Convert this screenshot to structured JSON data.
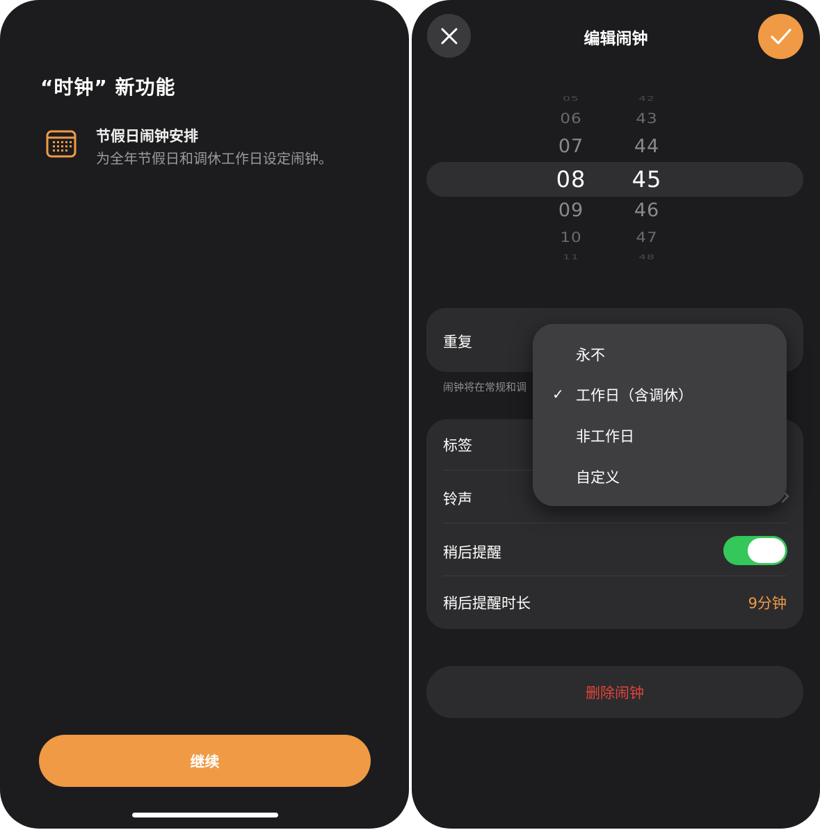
{
  "left_screen": {
    "title": "“时钟” 新功能",
    "feature": {
      "icon": "calendar-grid-icon",
      "title": "节假日闹钟安排",
      "description": "为全年节假日和调休工作日设定闹钟。"
    },
    "continue_label": "继续"
  },
  "right_screen": {
    "nav": {
      "title": "编辑闹钟",
      "close_icon": "close-icon",
      "confirm_icon": "checkmark-icon"
    },
    "picker": {
      "hours": [
        "05",
        "06",
        "07",
        "08",
        "09",
        "10",
        "11"
      ],
      "minutes": [
        "42",
        "43",
        "44",
        "45",
        "46",
        "47",
        "48"
      ],
      "selected_hour": "08",
      "selected_minute": "45"
    },
    "repeat": {
      "label": "重复",
      "footnote": "闹钟将在常规和调"
    },
    "repeat_menu": {
      "options": [
        {
          "label": "永不",
          "checked": false
        },
        {
          "label": "工作日（含调休）",
          "checked": true
        },
        {
          "label": "非工作日",
          "checked": false
        },
        {
          "label": "自定义",
          "checked": false
        }
      ],
      "check_glyph": "✓"
    },
    "settings": {
      "label_row": "标签",
      "sound_row": "铃声",
      "snooze_row": "稍后提醒",
      "snooze_enabled": true,
      "snooze_duration_row": "稍后提醒时长",
      "snooze_duration_value": "9分钟"
    },
    "delete_label": "删除闹钟"
  },
  "colors": {
    "accent_orange": "#f09a45",
    "toggle_green": "#34c759",
    "destructive_red": "#e0443a",
    "background": "#1c1c1e",
    "cell": "#2c2c2e"
  }
}
